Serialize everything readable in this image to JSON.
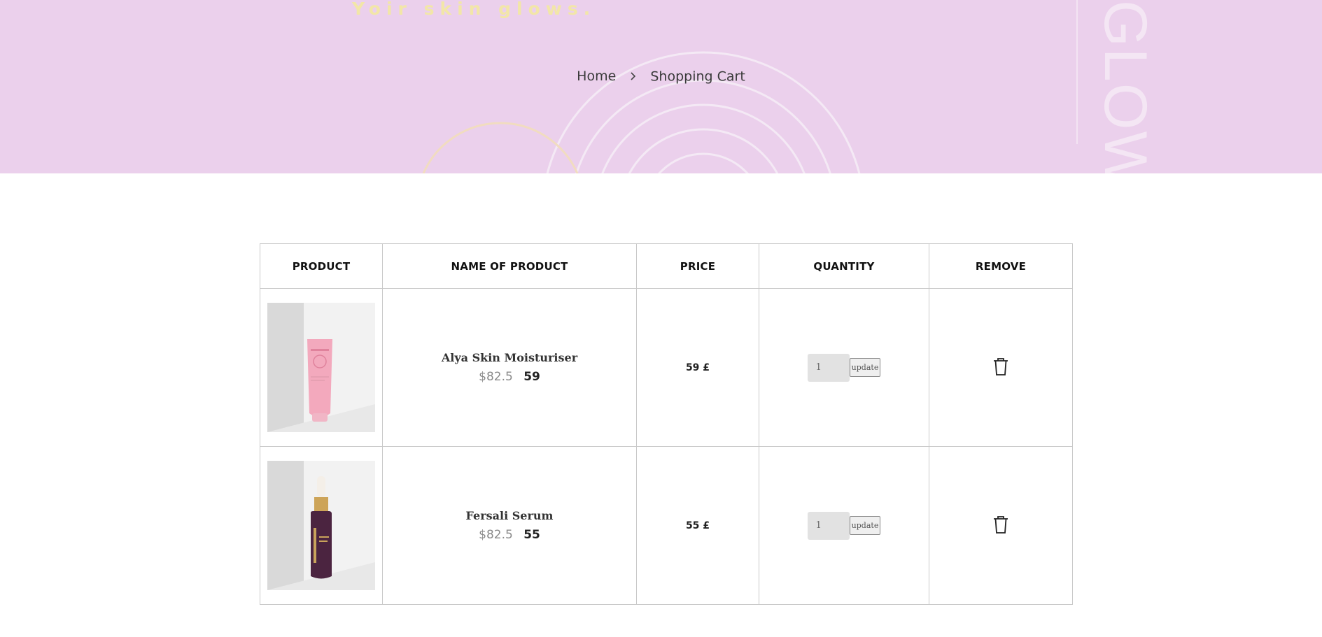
{
  "hero": {
    "tagline": "Yoir skin glows.",
    "vertical_text": "GLOW",
    "breadcrumb": {
      "home": "Home",
      "current": "Shopping Cart"
    },
    "colors": {
      "background": "#ebd0ec",
      "tagline": "#f2e6a8"
    }
  },
  "cart": {
    "headers": [
      "PRODUCT",
      "NAME OF PRODUCT",
      "PRICE",
      "QUANTITY",
      "REMOVE"
    ],
    "items": [
      {
        "image_icon": "pink-moisturiser-tube",
        "name": "Alya Skin Moisturiser",
        "old_price": "$82.5",
        "new_price": "59",
        "price": "59 £",
        "quantity": "1",
        "update_label": "update",
        "remove_icon": "trash-icon"
      },
      {
        "image_icon": "purple-serum-bottle",
        "name": "Fersali Serum",
        "old_price": "$82.5",
        "new_price": "55",
        "price": "55 £",
        "quantity": "1",
        "update_label": "update",
        "remove_icon": "trash-icon"
      }
    ]
  }
}
